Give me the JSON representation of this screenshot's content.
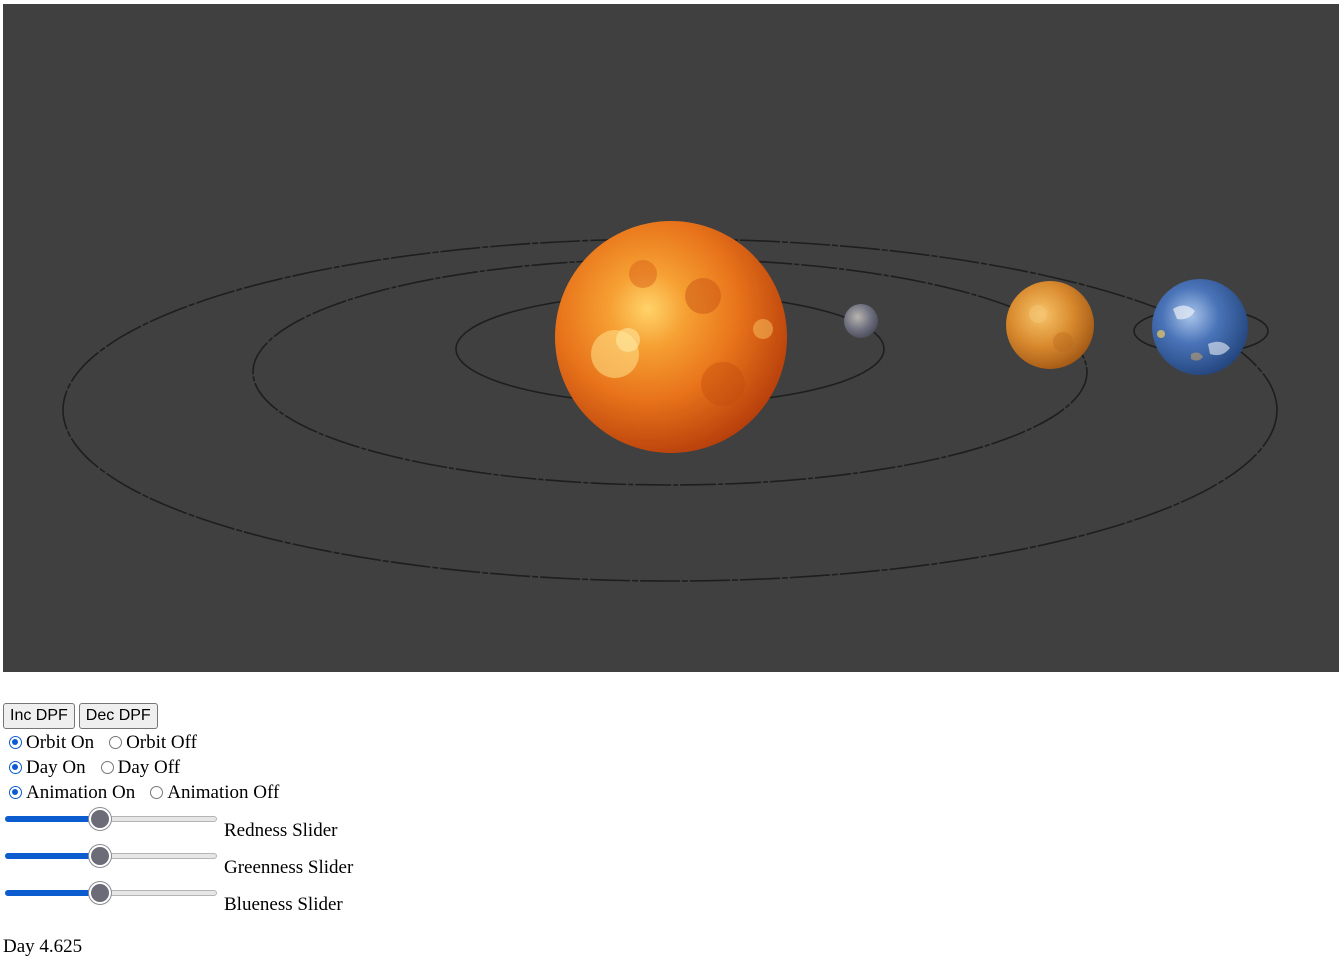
{
  "scene": {
    "background_color": "#404040",
    "bodies": [
      {
        "name": "sun-icon",
        "color": "#e8731a"
      },
      {
        "name": "mercury-icon",
        "color": "#6f7180"
      },
      {
        "name": "venus-icon",
        "color": "#d98a2e"
      },
      {
        "name": "earth-icon",
        "color": "#3c63a8"
      }
    ]
  },
  "buttons": {
    "inc_dpf": "Inc DPF",
    "dec_dpf": "Dec DPF"
  },
  "radio_groups": {
    "orbit": {
      "on": "Orbit On",
      "off": "Orbit Off",
      "selected": "on"
    },
    "day": {
      "on": "Day On",
      "off": "Day Off",
      "selected": "on"
    },
    "animation": {
      "on": "Animation On",
      "off": "Animation Off",
      "selected": "on"
    }
  },
  "sliders": {
    "redness": {
      "label": "Redness Slider",
      "value": 0.45
    },
    "greenness": {
      "label": "Greenness Slider",
      "value": 0.45
    },
    "blueness": {
      "label": "Blueness Slider",
      "value": 0.45
    }
  },
  "status": {
    "day_text": "Day 4.625"
  },
  "accent_color": "#0b5ccf"
}
